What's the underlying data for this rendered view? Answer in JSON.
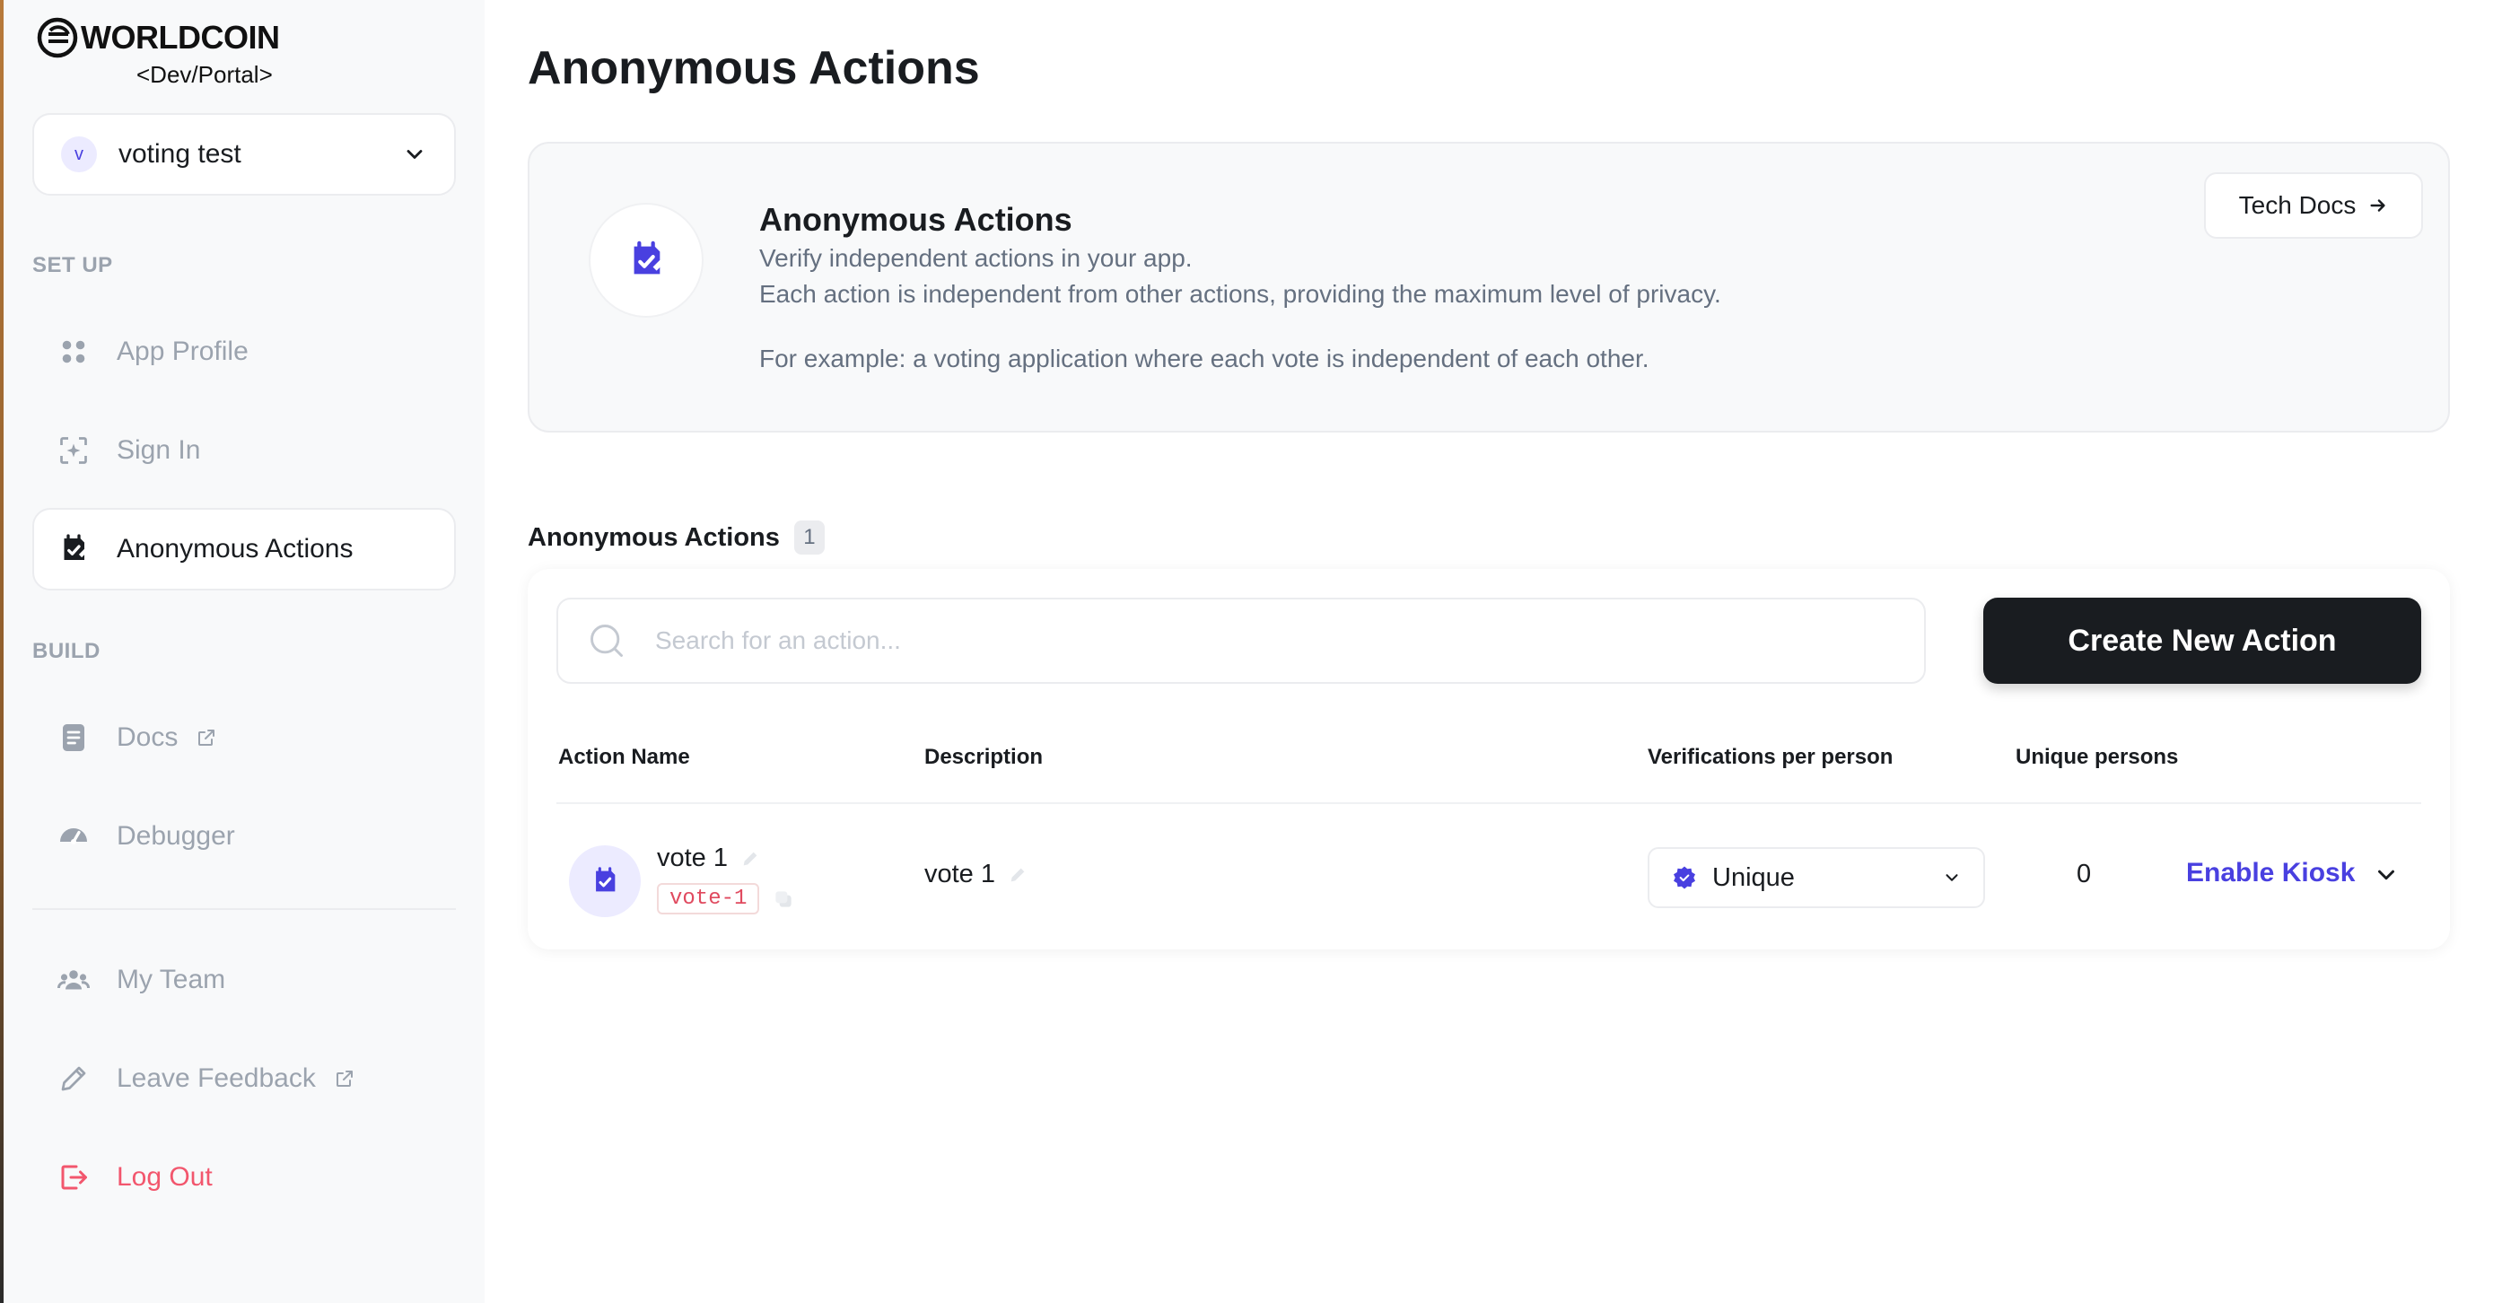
{
  "brand": {
    "wordmark": "WORLDCOIN",
    "subtitle": "<Dev/Portal>"
  },
  "team_select": {
    "initial": "v",
    "name": "voting test"
  },
  "sidebar": {
    "setup_label": "SET UP",
    "build_label": "BUILD",
    "items": [
      {
        "label": "App Profile",
        "icon": "apps-icon"
      },
      {
        "label": "Sign In",
        "icon": "sign-in-icon"
      },
      {
        "label": "Anonymous Actions",
        "icon": "anonymous-actions-icon",
        "active": true
      },
      {
        "label": "Docs",
        "icon": "docs-icon",
        "external": true
      },
      {
        "label": "Debugger",
        "icon": "debugger-icon"
      },
      {
        "label": "My Team",
        "icon": "team-icon"
      },
      {
        "label": "Leave Feedback",
        "icon": "pencil-icon",
        "external": true
      },
      {
        "label": "Log Out",
        "icon": "logout-icon"
      }
    ]
  },
  "page": {
    "title": "Anonymous Actions"
  },
  "info_card": {
    "title": "Anonymous Actions",
    "line1": "Verify independent actions in your app.",
    "line2": "Each action is independent from other actions, providing the maximum level of privacy.",
    "line3": "For example: a voting application where each vote is independent of each other.",
    "tech_docs_label": "Tech Docs"
  },
  "actions_list": {
    "heading": "Anonymous Actions",
    "count": "1",
    "search_placeholder": "Search for an action...",
    "create_label": "Create New Action",
    "columns": {
      "name": "Action Name",
      "description": "Description",
      "verifications": "Verifications per person",
      "unique": "Unique persons"
    },
    "rows": [
      {
        "name": "vote 1",
        "id": "vote-1",
        "description": "vote 1",
        "verifications": "Unique",
        "unique_persons": "0",
        "kiosk_label": "Enable Kiosk"
      }
    ]
  },
  "colors": {
    "accent": "#4940e0",
    "danger": "#f2566d",
    "primary_button": "#191c20",
    "muted_text": "#9ba3ae"
  }
}
